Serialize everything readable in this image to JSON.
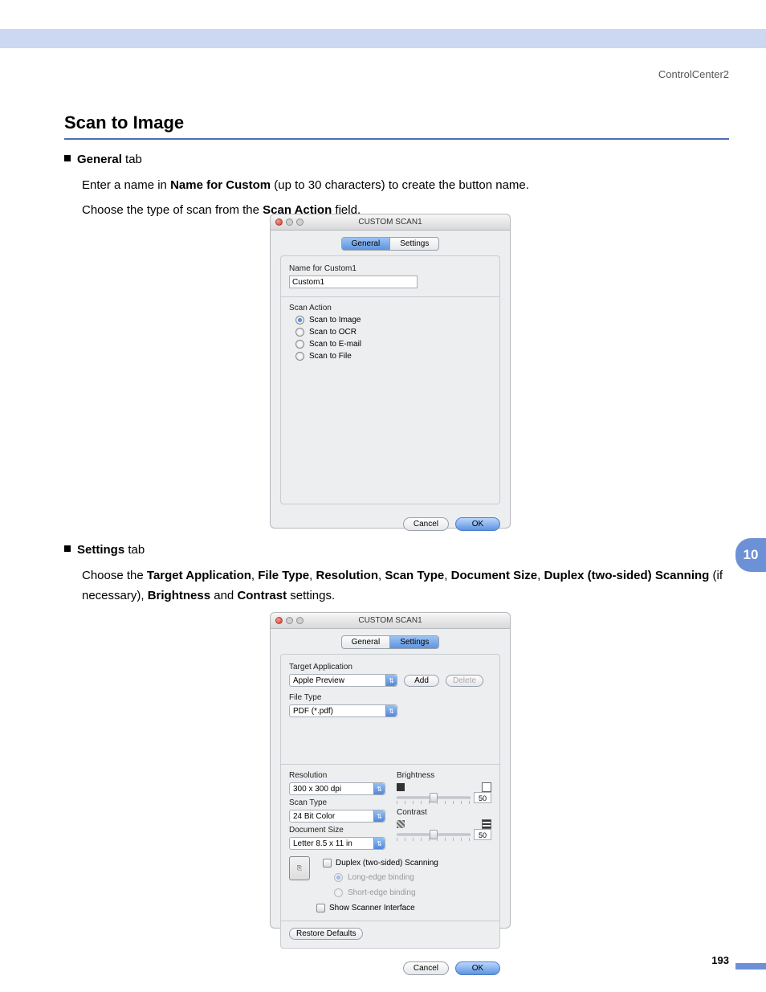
{
  "header": {
    "product": "ControlCenter2"
  },
  "heading": "Scan to Image",
  "section1": {
    "bullet_label_bold": "General",
    "bullet_label_rest": " tab",
    "line1_pre": "Enter a name in ",
    "line1_bold": "Name for Custom",
    "line1_post": " (up to 30 characters) to create the button name.",
    "line2_pre": "Choose the type of scan from the ",
    "line2_bold": "Scan Action",
    "line2_post": " field."
  },
  "section2": {
    "bullet_label_bold": "Settings",
    "bullet_label_rest": " tab",
    "line1_a": "Choose the ",
    "b1": "Target Application",
    "c1": ", ",
    "b2": "File Type",
    "c2": ", ",
    "b3": "Resolution",
    "c3": ", ",
    "b4": "Scan Type",
    "c4": ", ",
    "b5": "Document Size",
    "c5": ", ",
    "b6": "Duplex (two-sided) Scanning",
    "c6": " (if necessary), ",
    "b7": "Brightness",
    "c7": " and ",
    "b8": "Contrast",
    "c8": " settings."
  },
  "dialog_general": {
    "title": "CUSTOM SCAN1",
    "tab_general": "General",
    "tab_settings": "Settings",
    "name_label": "Name for Custom1",
    "name_value": "Custom1",
    "scan_action_label": "Scan Action",
    "opt_image": "Scan to Image",
    "opt_ocr": "Scan to OCR",
    "opt_email": "Scan to E-mail",
    "opt_file": "Scan to File",
    "cancel": "Cancel",
    "ok": "OK"
  },
  "dialog_settings": {
    "title": "CUSTOM SCAN1",
    "tab_general": "General",
    "tab_settings": "Settings",
    "target_label": "Target Application",
    "target_value": "Apple Preview",
    "add": "Add",
    "delete": "Delete",
    "filetype_label": "File Type",
    "filetype_value": "PDF (*.pdf)",
    "resolution_label": "Resolution",
    "resolution_value": "300 x 300 dpi",
    "scantype_label": "Scan Type",
    "scantype_value": "24 Bit Color",
    "docsize_label": "Document Size",
    "docsize_value": "Letter  8.5 x 11 in",
    "brightness_label": "Brightness",
    "brightness_value": "50",
    "contrast_label": "Contrast",
    "contrast_value": "50",
    "duplex_label": "Duplex (two-sided) Scanning",
    "longedge": "Long-edge binding",
    "shortedge": "Short-edge binding",
    "show_scanner": "Show Scanner Interface",
    "restore": "Restore Defaults",
    "cancel": "Cancel",
    "ok": "OK"
  },
  "side_tab": "10",
  "page_number": "193"
}
